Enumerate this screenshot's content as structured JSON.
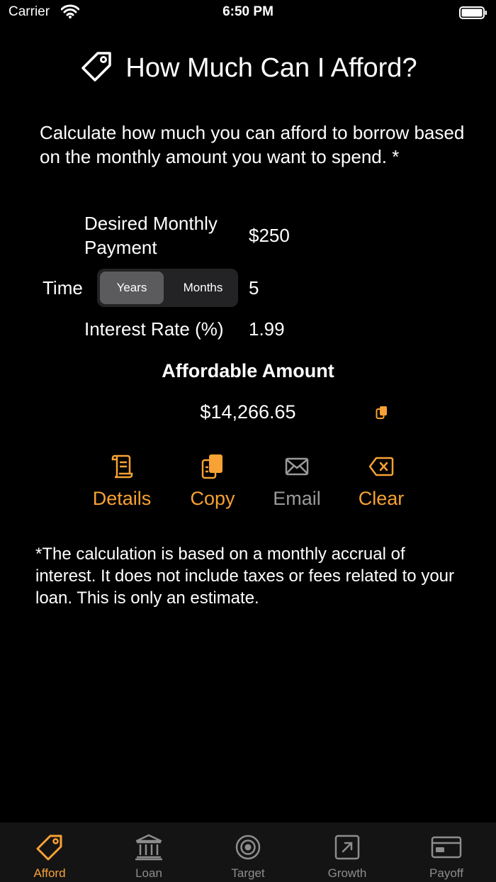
{
  "status": {
    "carrier": "Carrier",
    "time": "6:50 PM"
  },
  "header": {
    "title": "How Much Can I Afford?"
  },
  "intro": "Calculate how much you can afford to borrow based on the monthly amount you want to spend. *",
  "form": {
    "payment_label": "Desired Monthly Payment",
    "payment_value": "$250",
    "time_label": "Time",
    "time_value": "5",
    "time_units": [
      "Years",
      "Months"
    ],
    "time_selected": "Years",
    "rate_label": "Interest Rate (%)",
    "rate_value": "1.99"
  },
  "result": {
    "heading": "Affordable Amount",
    "amount": "$14,266.65"
  },
  "actions": [
    {
      "label": "Details",
      "icon": "scroll-icon"
    },
    {
      "label": "Copy",
      "icon": "copy-icon"
    },
    {
      "label": "Email",
      "icon": "envelope-icon"
    },
    {
      "label": "Clear",
      "icon": "delete-icon"
    }
  ],
  "footnote": "*The calculation is based on a monthly accrual of interest.  It does not include taxes or fees related to your loan.  This is only an estimate.",
  "tabs": [
    {
      "label": "Afford",
      "icon": "tag-icon",
      "active": true
    },
    {
      "label": "Loan",
      "icon": "bank-icon"
    },
    {
      "label": "Target",
      "icon": "target-icon"
    },
    {
      "label": "Growth",
      "icon": "arrow-up-right-square-icon"
    },
    {
      "label": "Payoff",
      "icon": "credit-card-icon"
    }
  ],
  "colors": {
    "accent": "#f7a234",
    "background": "#000000",
    "inactive": "#8d8d8d"
  }
}
